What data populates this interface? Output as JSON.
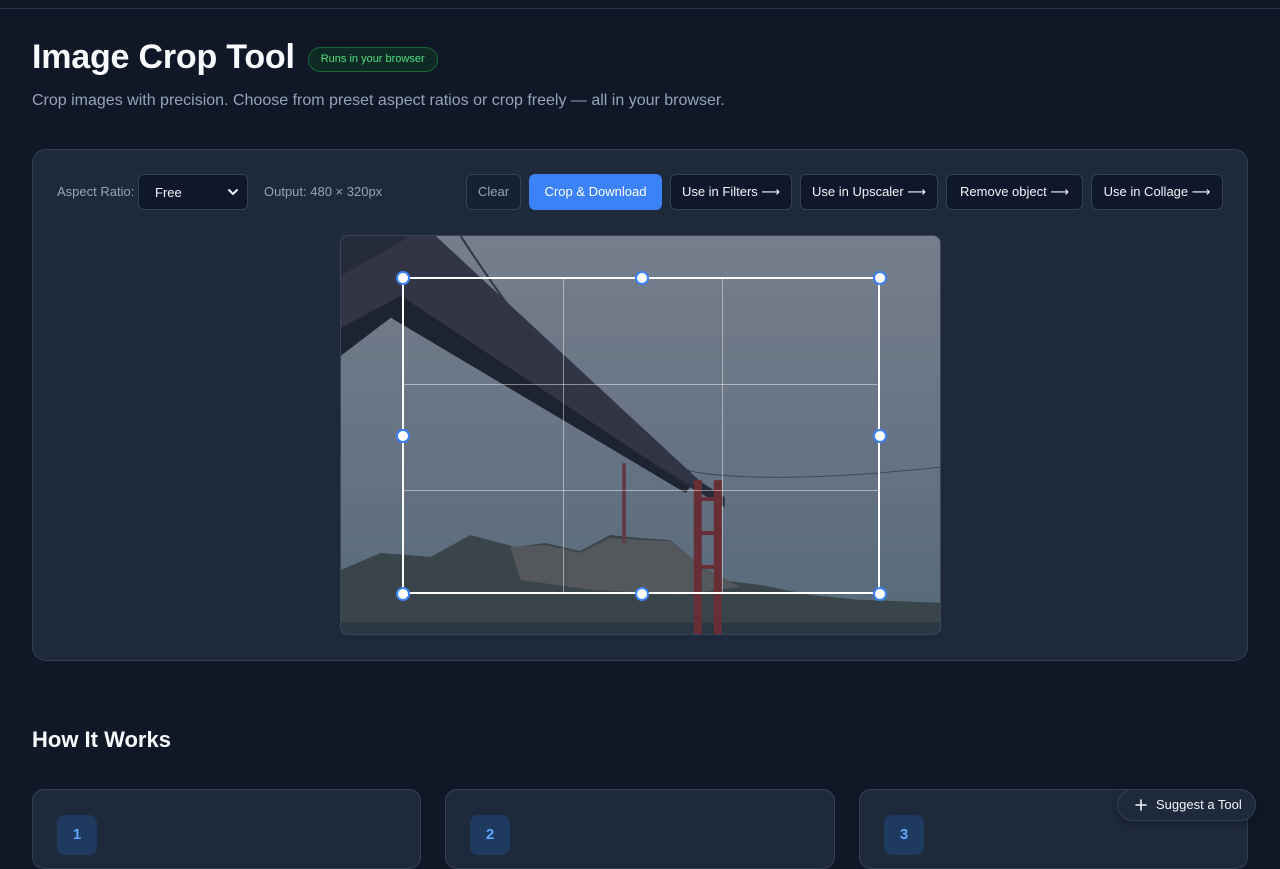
{
  "header": {
    "title": "Image Crop Tool",
    "badge": "Runs in your browser",
    "subtitle": "Crop images with precision. Choose from preset aspect ratios or crop freely — all in your browser."
  },
  "toolbar": {
    "aspect_label": "Aspect Ratio:",
    "aspect_value": "Free",
    "output_text": "Output: 480 × 320px",
    "clear_label": "Clear",
    "crop_download_label": "Crop & Download",
    "filters_label": "Use in Filters ⟶",
    "upscaler_label": "Use in Upscaler ⟶",
    "remove_object_label": "Remove object ⟶",
    "collage_label": "Use in Collage ⟶"
  },
  "colors": {
    "accent": "#3b82f6",
    "badge_text": "#4ade80",
    "background": "#101828",
    "panel": "#1e293b"
  },
  "how_it_works": {
    "title": "How It Works",
    "steps": [
      {
        "number": "1"
      },
      {
        "number": "2"
      },
      {
        "number": "3"
      }
    ]
  },
  "suggest": {
    "label": "Suggest a Tool",
    "icon": "plus-icon"
  }
}
